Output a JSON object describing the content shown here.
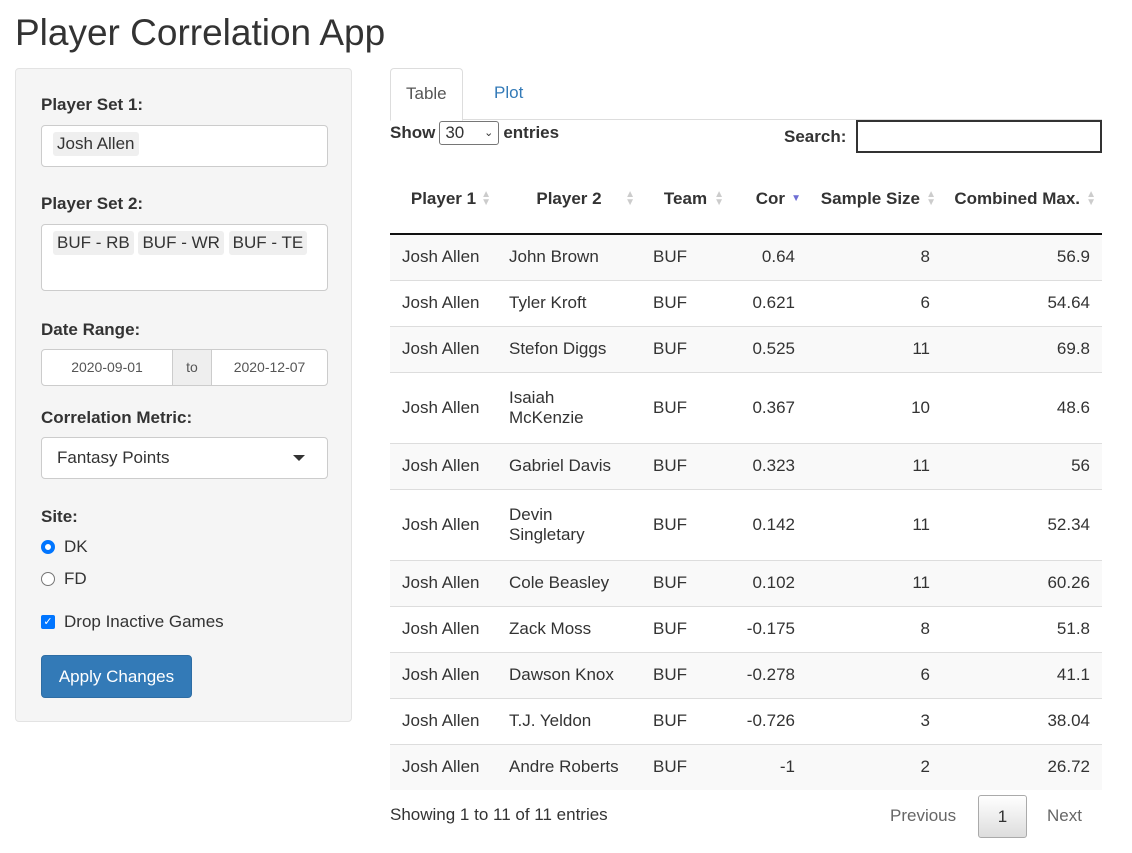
{
  "title": "Player Correlation App",
  "sidebar": {
    "player_set_1": {
      "label": "Player Set 1:",
      "values": [
        "Josh Allen"
      ]
    },
    "player_set_2": {
      "label": "Player Set 2:",
      "values": [
        "BUF - RB",
        "BUF - WR",
        "BUF - TE"
      ]
    },
    "date_range": {
      "label": "Date Range:",
      "start": "2020-09-01",
      "sep": "to",
      "end": "2020-12-07"
    },
    "metric": {
      "label": "Correlation Metric:",
      "value": "Fantasy Points"
    },
    "site": {
      "label": "Site:",
      "options": [
        "DK",
        "FD"
      ],
      "selected": "DK"
    },
    "drop_inactive": {
      "label": "Drop Inactive Games",
      "checked": true
    },
    "apply": "Apply Changes"
  },
  "tabs": [
    "Table",
    "Plot"
  ],
  "table_controls": {
    "show": "Show",
    "length": "30",
    "entries": "entries",
    "search_label": "Search:",
    "search_value": ""
  },
  "columns": [
    "Player 1",
    "Player 2",
    "Team",
    "Cor",
    "Sample Size",
    "Combined Max."
  ],
  "sort": {
    "column": "Cor",
    "direction": "desc",
    "color": "#6e6ed4"
  },
  "rows": [
    [
      "Josh Allen",
      "John Brown",
      "BUF",
      "0.64",
      "8",
      "56.9"
    ],
    [
      "Josh Allen",
      "Tyler Kroft",
      "BUF",
      "0.621",
      "6",
      "54.64"
    ],
    [
      "Josh Allen",
      "Stefon Diggs",
      "BUF",
      "0.525",
      "11",
      "69.8"
    ],
    [
      "Josh Allen",
      "Isaiah McKenzie",
      "BUF",
      "0.367",
      "10",
      "48.6"
    ],
    [
      "Josh Allen",
      "Gabriel Davis",
      "BUF",
      "0.323",
      "11",
      "56"
    ],
    [
      "Josh Allen",
      "Devin Singletary",
      "BUF",
      "0.142",
      "11",
      "52.34"
    ],
    [
      "Josh Allen",
      "Cole Beasley",
      "BUF",
      "0.102",
      "11",
      "60.26"
    ],
    [
      "Josh Allen",
      "Zack Moss",
      "BUF",
      "-0.175",
      "8",
      "51.8"
    ],
    [
      "Josh Allen",
      "Dawson Knox",
      "BUF",
      "-0.278",
      "6",
      "41.1"
    ],
    [
      "Josh Allen",
      "T.J. Yeldon",
      "BUF",
      "-0.726",
      "3",
      "38.04"
    ],
    [
      "Josh Allen",
      "Andre Roberts",
      "BUF",
      "-1",
      "2",
      "26.72"
    ]
  ],
  "footer": {
    "info": "Showing 1 to 11 of 11 entries",
    "previous": "Previous",
    "page": "1",
    "next": "Next"
  }
}
